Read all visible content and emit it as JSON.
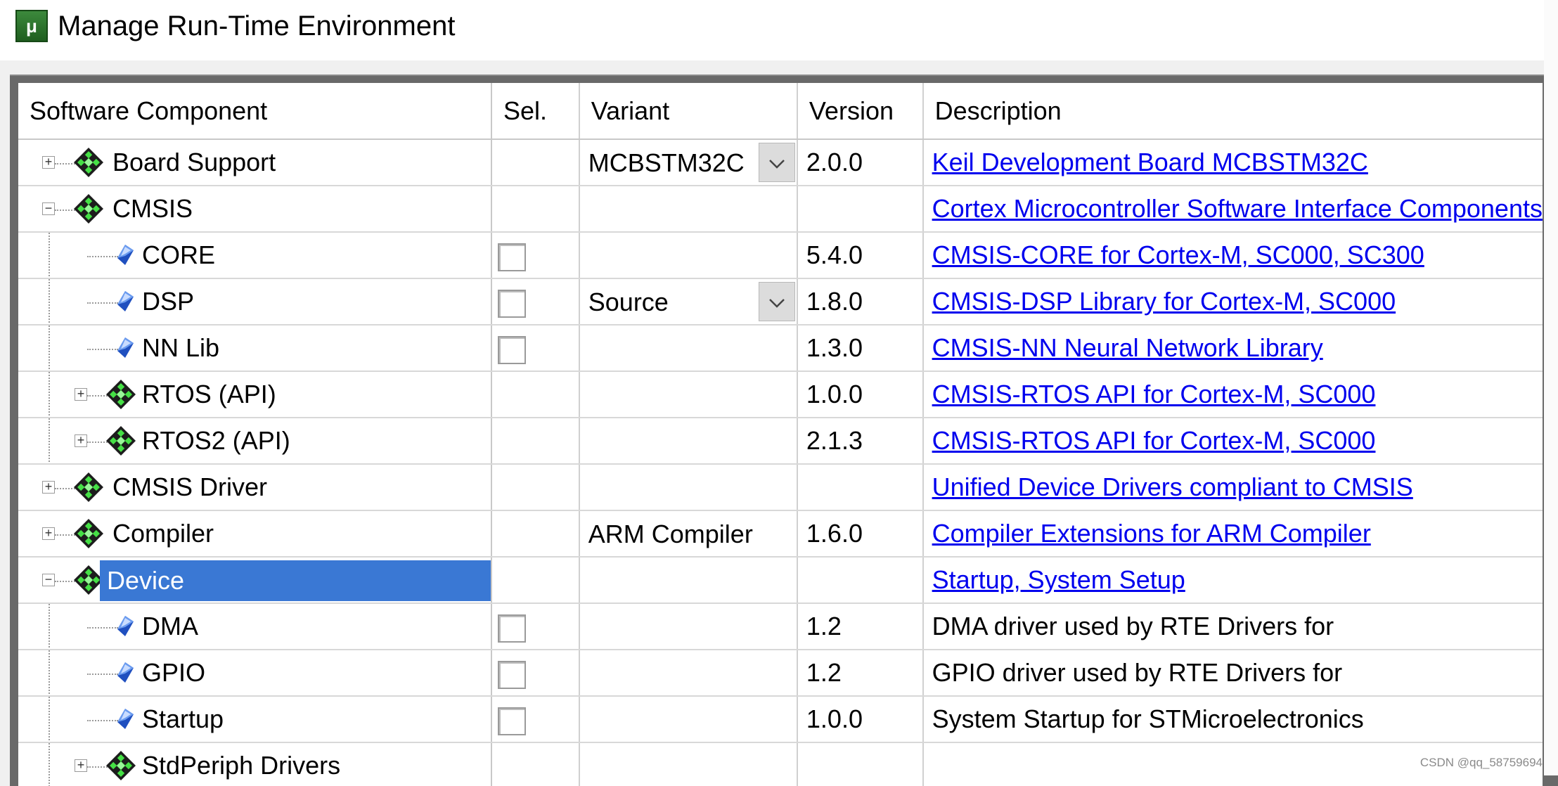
{
  "window": {
    "title": "Manage Run-Time Environment",
    "icon": "keil-uv-icon"
  },
  "columns": {
    "component": "Software Component",
    "sel": "Sel.",
    "variant": "Variant",
    "version": "Version",
    "description": "Description"
  },
  "rows": [
    {
      "name": "Board Support",
      "level": 0,
      "expander": "+",
      "icon": "gem-icon",
      "checkbox": false,
      "variant": "MCBSTM32C",
      "dropdown": true,
      "version": "2.0.0",
      "description": "Keil Development Board MCBSTM32C",
      "link": true
    },
    {
      "name": "CMSIS",
      "level": 0,
      "expander": "-",
      "icon": "gem-icon",
      "checkbox": false,
      "variant": "",
      "dropdown": false,
      "version": "",
      "description": "Cortex Microcontroller Software Interface Components",
      "link": true
    },
    {
      "name": "CORE",
      "level": 1,
      "expander": "",
      "icon": "diamond-icon",
      "checkbox": true,
      "variant": "",
      "dropdown": false,
      "version": "5.4.0",
      "description": "CMSIS-CORE for Cortex-M, SC000, SC300",
      "link": true
    },
    {
      "name": "DSP",
      "level": 1,
      "expander": "",
      "icon": "diamond-icon",
      "checkbox": true,
      "variant": "Source",
      "dropdown": true,
      "version": "1.8.0",
      "description": "CMSIS-DSP Library for Cortex-M, SC000",
      "link": true
    },
    {
      "name": "NN Lib",
      "level": 1,
      "expander": "",
      "icon": "diamond-icon",
      "checkbox": true,
      "variant": "",
      "dropdown": false,
      "version": "1.3.0",
      "description": "CMSIS-NN Neural Network Library",
      "link": true
    },
    {
      "name": "RTOS (API)",
      "level": 1,
      "expander": "+",
      "icon": "gem-icon",
      "checkbox": false,
      "variant": "",
      "dropdown": false,
      "version": "1.0.0",
      "description": "CMSIS-RTOS API for Cortex-M, SC000",
      "link": true
    },
    {
      "name": "RTOS2 (API)",
      "level": 1,
      "expander": "+",
      "icon": "gem-icon",
      "checkbox": false,
      "variant": "",
      "dropdown": false,
      "version": "2.1.3",
      "description": "CMSIS-RTOS API for Cortex-M, SC000",
      "link": true
    },
    {
      "name": "CMSIS Driver",
      "level": 0,
      "expander": "+",
      "icon": "gem-icon",
      "checkbox": false,
      "variant": "",
      "dropdown": false,
      "version": "",
      "description": "Unified Device Drivers compliant to CMSIS",
      "link": true
    },
    {
      "name": "Compiler",
      "level": 0,
      "expander": "+",
      "icon": "gem-icon",
      "checkbox": false,
      "variant": "ARM Compiler",
      "dropdown": false,
      "version": "1.6.0",
      "description": "Compiler Extensions for ARM Compiler",
      "link": true
    },
    {
      "name": "Device",
      "level": 0,
      "expander": "-",
      "icon": "gem-icon",
      "checkbox": false,
      "variant": "",
      "dropdown": false,
      "version": "",
      "description": "Startup, System Setup",
      "link": true,
      "selected": true
    },
    {
      "name": "DMA",
      "level": 1,
      "expander": "",
      "icon": "diamond-icon",
      "checkbox": true,
      "variant": "",
      "dropdown": false,
      "version": "1.2",
      "description": "DMA driver used by RTE Drivers for",
      "link": false
    },
    {
      "name": "GPIO",
      "level": 1,
      "expander": "",
      "icon": "diamond-icon",
      "checkbox": true,
      "variant": "",
      "dropdown": false,
      "version": "1.2",
      "description": "GPIO driver used by RTE Drivers for",
      "link": false
    },
    {
      "name": "Startup",
      "level": 1,
      "expander": "",
      "icon": "diamond-icon",
      "checkbox": true,
      "variant": "",
      "dropdown": false,
      "version": "1.0.0",
      "description": "System Startup for STMicroelectronics",
      "link": false
    },
    {
      "name": "StdPeriph Drivers",
      "level": 1,
      "expander": "+",
      "icon": "gem-icon",
      "checkbox": false,
      "variant": "",
      "dropdown": false,
      "version": "",
      "description": "",
      "link": false
    }
  ],
  "colors": {
    "selection": "#3a78d4",
    "link": "#0000ee",
    "gem_green": "#3ddc3d"
  },
  "watermark": "CSDN @qq_58759694"
}
